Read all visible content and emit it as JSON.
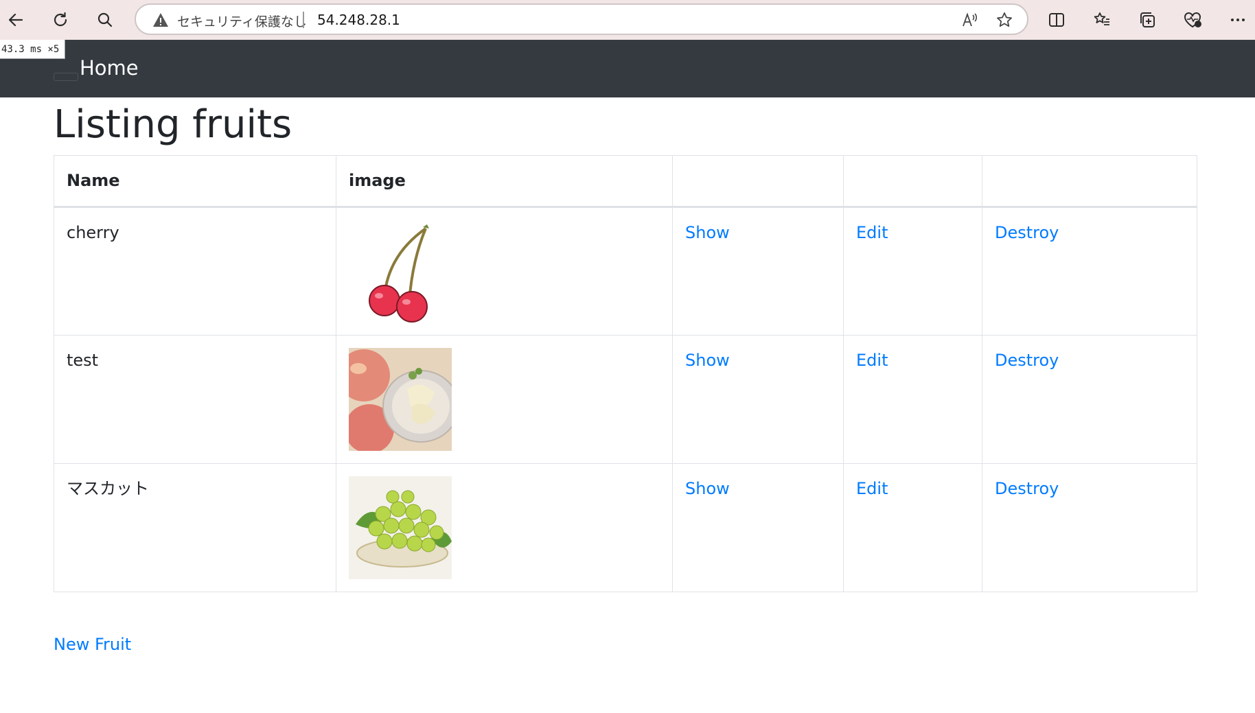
{
  "browser": {
    "security_text": "セキュリティ保護なし",
    "url": "54.248.28.1"
  },
  "perf_badge": "43.3 ms ×5",
  "navbar": {
    "home_label": "Home"
  },
  "page": {
    "title": "Listing fruits",
    "columns": [
      "Name",
      "image",
      "",
      "",
      ""
    ],
    "rows": [
      {
        "name": "cherry",
        "image": "cherry-illustration",
        "show": "Show",
        "edit": "Edit",
        "destroy": "Destroy"
      },
      {
        "name": "test",
        "image": "peach-photo",
        "show": "Show",
        "edit": "Edit",
        "destroy": "Destroy"
      },
      {
        "name": "マスカット",
        "image": "muscat-grapes-photo",
        "show": "Show",
        "edit": "Edit",
        "destroy": "Destroy"
      }
    ],
    "new_link": "New Fruit"
  },
  "colors": {
    "navbar_bg": "#343a40",
    "link": "#007bff",
    "browser_bar_bg": "#f2e6e6"
  }
}
